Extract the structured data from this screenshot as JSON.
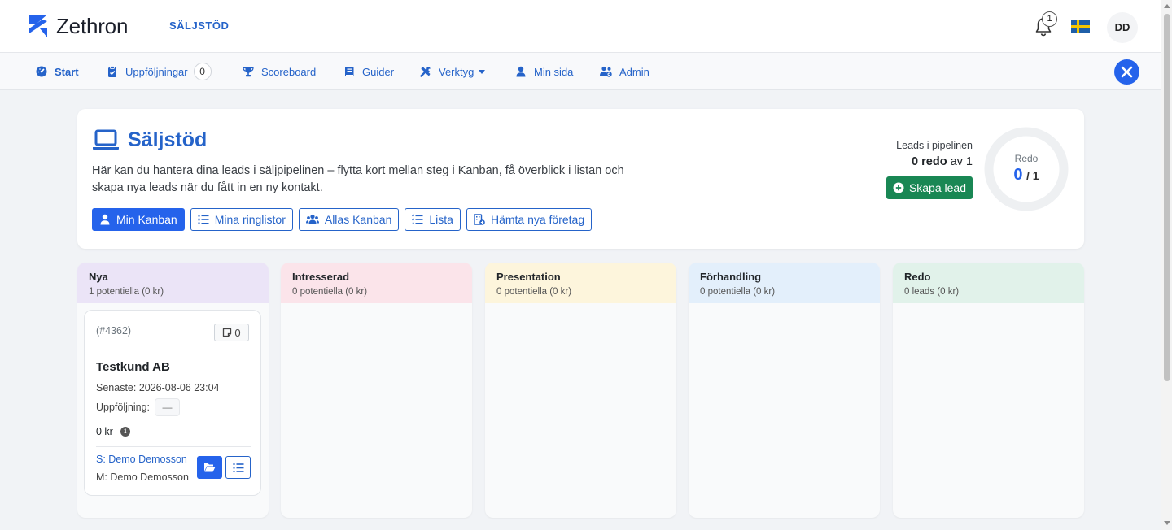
{
  "header": {
    "logo_text": "Zethron",
    "app_title": "SÄLJSTÖD",
    "notification_count": "1",
    "language": "Svenska",
    "user_initials": "DD"
  },
  "nav": {
    "items": [
      {
        "label": "Start",
        "icon": "gauge-icon"
      },
      {
        "label": "Uppföljningar",
        "icon": "clipboard-check-icon",
        "count": "0"
      },
      {
        "label": "Scoreboard",
        "icon": "trophy-icon"
      },
      {
        "label": "Guider",
        "icon": "book-icon"
      },
      {
        "label": "Verktyg",
        "icon": "tools-icon"
      },
      {
        "label": "Min sida",
        "icon": "user-icon"
      },
      {
        "label": "Admin",
        "icon": "users-cog-icon"
      }
    ]
  },
  "hero": {
    "title": "Säljstöd",
    "description": "Här kan du hantera dina leads i säljpipelinen – flytta kort mellan steg i Kanban, få överblick i listan och skapa nya leads när du fått in en ny kontakt.",
    "buttons": [
      "Min Kanban",
      "Mina ringlistor",
      "Allas Kanban",
      "Lista",
      "Hämta nya företag"
    ],
    "pipeline_label": "Leads i pipelinen",
    "pipeline_ready": "0 redo",
    "pipeline_of": "av 1",
    "create_label": "Skapa lead",
    "ring_label": "Redo",
    "ring_value": "0",
    "ring_total": "/ 1",
    "ring_fraction": 0,
    "accent_color": "#2563eb"
  },
  "kanban": {
    "columns": [
      {
        "name": "Nya",
        "summary": "1 potentiella (0 kr)",
        "color": "#ebe4f7"
      },
      {
        "name": "Intresserad",
        "summary": "0 potentiella (0 kr)",
        "color": "#fbe4ea"
      },
      {
        "name": "Presentation",
        "summary": "0 potentiella (0 kr)",
        "color": "#fdf5dc"
      },
      {
        "name": "Förhandling",
        "summary": "0 potentiella (0 kr)",
        "color": "#e3effb"
      },
      {
        "name": "Redo",
        "summary": "0 leads (0 kr)",
        "color": "#e1f2ea"
      }
    ],
    "lead": {
      "id": "(#4362)",
      "notes": "0",
      "name": "Testkund AB",
      "last": "Senaste: 2026-08-06 23:04",
      "followup_label": "Uppföljning:",
      "followup_value": "—",
      "amount": "0 kr",
      "seller": "S: Demo Demosson",
      "manager": "M: Demo Demosson"
    }
  }
}
